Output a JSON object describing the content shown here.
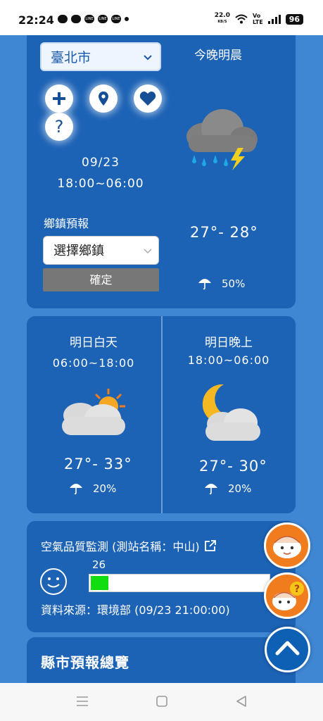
{
  "status": {
    "time": "22:24",
    "speed": "22.0",
    "speed_unit": "KB/S",
    "volte_top": "Vo",
    "volte_bottom": "LTE",
    "battery": "96"
  },
  "tonight": {
    "city": "臺北市",
    "title": "今晚明晨",
    "date": "09/23",
    "time": "18:00~06:00",
    "temp": "27°- 28°",
    "rain": "50%",
    "town_label": "鄉鎮預報",
    "town_placeholder": "選擇鄉鎮",
    "confirm": "確定"
  },
  "tomorrow_day": {
    "title": "明日白天",
    "time": "06:00~18:00",
    "temp": "27°- 33°",
    "rain": "20%"
  },
  "tomorrow_night": {
    "title": "明日晚上",
    "time": "18:00~06:00",
    "temp": "27°- 30°",
    "rain": "20%"
  },
  "air": {
    "title": "空氣品質監測 (測站名稱：中山)",
    "value": "26",
    "level_fraction": 0.1,
    "source": "資料來源：環境部 (09/23 21:00:00)"
  },
  "overview": {
    "title": "縣市預報總覽"
  },
  "colors": {
    "panel": "#1c62b5",
    "background": "#3f86d3",
    "aq_good": "#11dd11",
    "fab_orange": "#f07c1e"
  },
  "icons": [
    "plus-icon",
    "location-pin-icon",
    "heart-icon",
    "question-icon",
    "rain-thunder-cloud-icon",
    "partly-sunny-icon",
    "moon-cloud-icon",
    "umbrella-icon",
    "smiley-icon",
    "external-link-icon",
    "chevron-up-icon"
  ]
}
